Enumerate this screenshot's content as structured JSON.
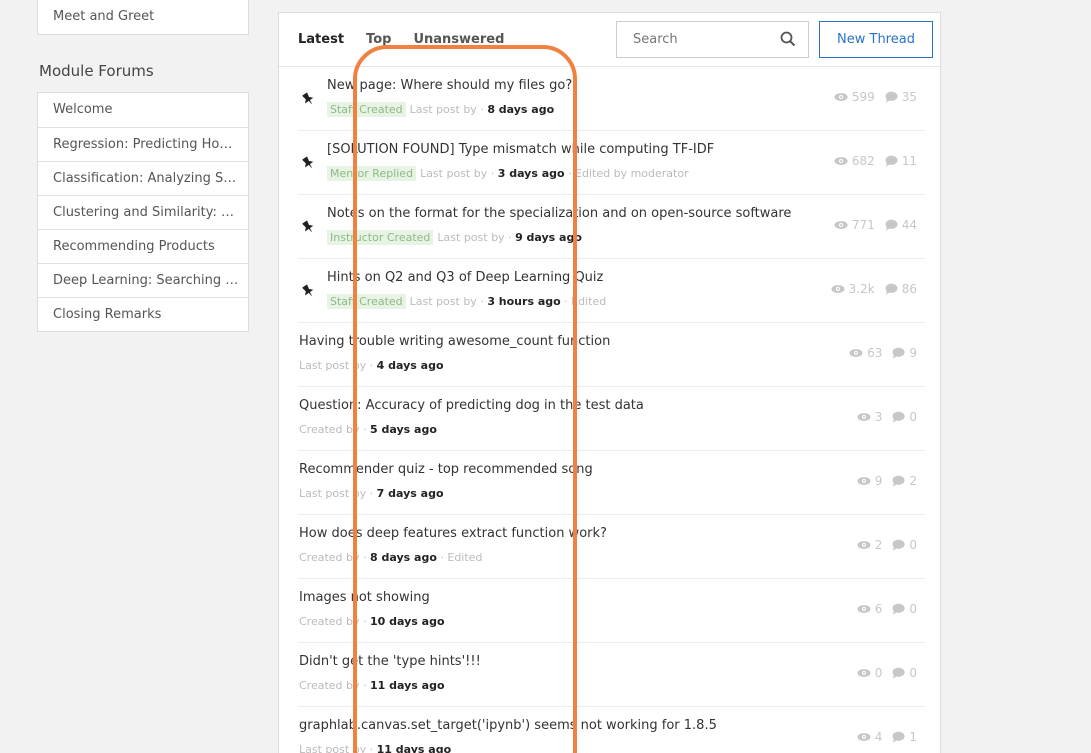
{
  "sidebar": {
    "top_item": "Meet and Greet",
    "heading": "Module Forums",
    "items": [
      "Welcome",
      "Regression: Predicting Hous...",
      "Classification: Analyzing Sen...",
      "Clustering and Similarity: Re...",
      "Recommending Products",
      "Deep Learning: Searching fo...",
      "Closing Remarks"
    ]
  },
  "toolbar": {
    "tabs": [
      "Latest",
      "Top",
      "Unanswered"
    ],
    "search_placeholder": "Search",
    "new_thread_label": "New Thread"
  },
  "threads": [
    {
      "title": "New page: Where should my files go?",
      "badge": "Staff Created",
      "pre": "Last post by",
      "time": "8 days ago",
      "post": "",
      "views": "599",
      "replies": "35",
      "pinned": true
    },
    {
      "title": "[SOLUTION FOUND] Type mismatch while computing TF-IDF",
      "badge": "Mentor Replied",
      "pre": "Last post by",
      "time": "3 days ago",
      "post": "· Edited by moderator",
      "views": "682",
      "replies": "11",
      "pinned": true
    },
    {
      "title": "Notes on the format for the specialization and on open-source software",
      "badge": "Instructor Created",
      "pre": "Last post by",
      "time": "9 days ago",
      "post": "",
      "views": "771",
      "replies": "44",
      "pinned": true
    },
    {
      "title": "Hints on Q2 and Q3 of Deep Learning Quiz",
      "badge": "Staff Created",
      "pre": "Last post by",
      "time": "3 hours ago",
      "post": "· Edited",
      "views": "3.2k",
      "replies": "86",
      "pinned": true
    },
    {
      "title": "Having trouble writing awesome_count function",
      "badge": "",
      "pre": "Last post by",
      "time": "4 days ago",
      "post": "",
      "views": "63",
      "replies": "9",
      "pinned": false
    },
    {
      "title": "Question: Accuracy of predicting dog in the test data",
      "badge": "",
      "pre": "Created by",
      "time": "5 days ago",
      "post": "",
      "views": "3",
      "replies": "0",
      "pinned": false
    },
    {
      "title": "Recommender quiz - top recommended song",
      "badge": "",
      "pre": "Last post by",
      "time": "7 days ago",
      "post": "",
      "views": "9",
      "replies": "2",
      "pinned": false
    },
    {
      "title": "How does deep features extract function work?",
      "badge": "",
      "pre": "Created by",
      "time": "8 days ago",
      "post": "· Edited",
      "views": "2",
      "replies": "0",
      "pinned": false
    },
    {
      "title": "Images not showing",
      "badge": "",
      "pre": "Created by",
      "time": "10 days ago",
      "post": "",
      "views": "6",
      "replies": "0",
      "pinned": false
    },
    {
      "title": "Didn't get the 'type hints'!!!",
      "badge": "",
      "pre": "Created by",
      "time": "11 days ago",
      "post": "",
      "views": "0",
      "replies": "0",
      "pinned": false
    },
    {
      "title": "graphlab.canvas.set_target('ipynb') seems not working for 1.8.5",
      "badge": "",
      "pre": "Last post by",
      "time": "11 days ago",
      "post": "",
      "views": "4",
      "replies": "1",
      "pinned": false
    }
  ],
  "colors": {
    "accent": "#2a73cc",
    "highlight": "#f08141",
    "badge_bg": "#e7f4e4"
  }
}
